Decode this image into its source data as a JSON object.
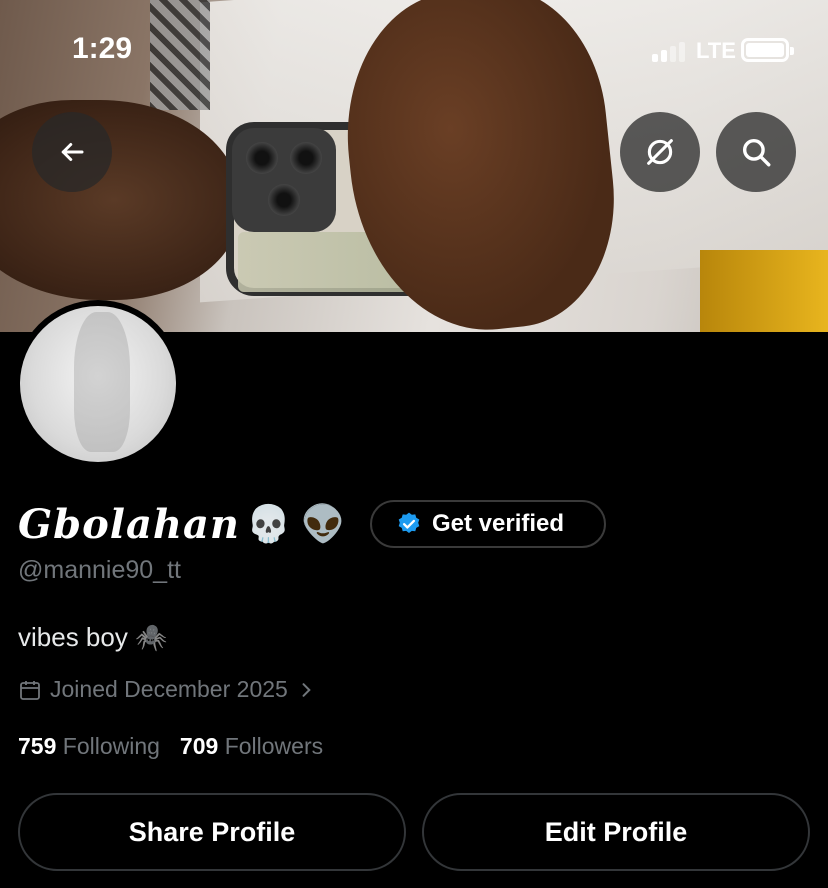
{
  "status_bar": {
    "time": "1:29",
    "network": "LTE"
  },
  "header": {
    "back_icon": "arrow-left-icon",
    "grok_icon": "grok-icon",
    "search_icon": "search-icon"
  },
  "profile": {
    "display_name": "Gbolahan",
    "name_emojis": "💀 👽",
    "verify_label": "Get verified",
    "handle": "@mannie90_tt",
    "bio": "vibes boy 🕷️",
    "joined": "Joined December 2025",
    "following_count": "759",
    "following_label": "Following",
    "followers_count": "709",
    "followers_label": "Followers"
  },
  "actions": {
    "share_label": "Share Profile",
    "edit_label": "Edit Profile"
  },
  "colors": {
    "background": "#000000",
    "muted": "#71767b",
    "verified_blue": "#1d9bf0"
  }
}
